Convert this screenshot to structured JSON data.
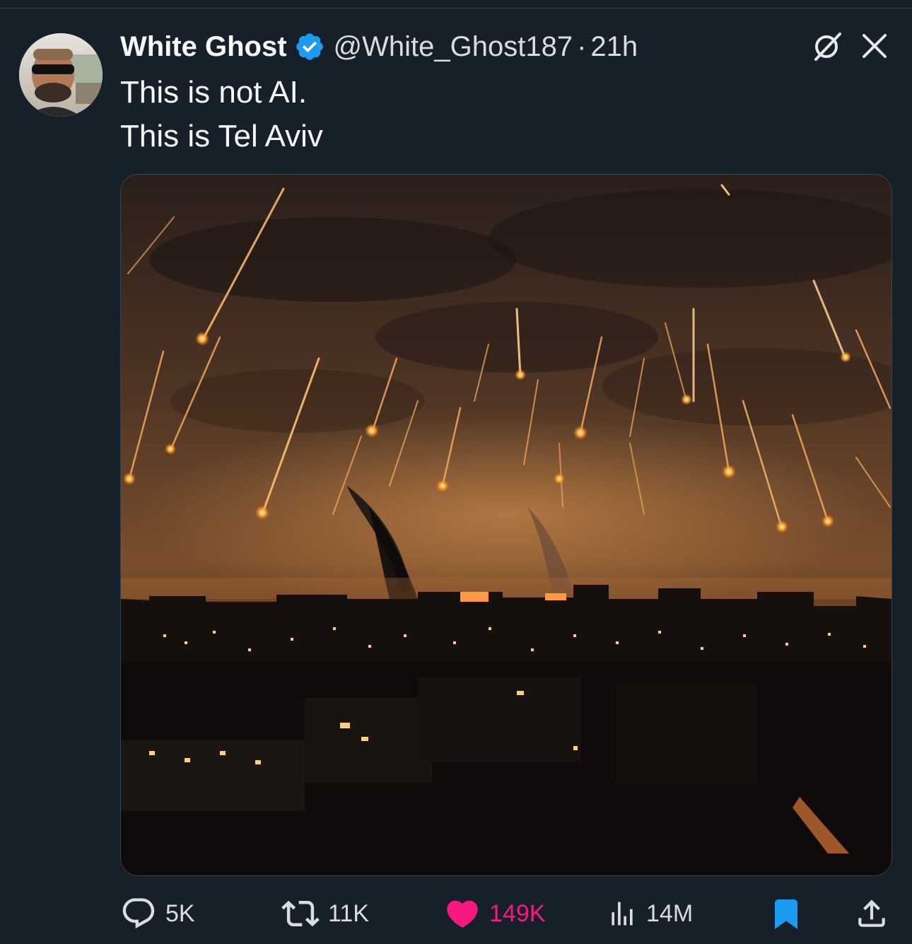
{
  "tweet": {
    "author_name": "White Ghost",
    "author_handle": "@White_Ghost187",
    "separator": "·",
    "time": "21h",
    "text_line1": "This is not AI.",
    "text_line2": "This is Tel Aviv",
    "verified_icon": "verified-badge-icon",
    "media_description_icon": "night-sky-photo"
  },
  "metrics": {
    "replies": "5K",
    "retweets": "11K",
    "likes": "149K",
    "views": "14M"
  },
  "colors": {
    "background": "#15202b",
    "text": "#f7f9f9",
    "secondary": "#d9dde0",
    "verified": "#1d9bf0",
    "like": "#f91880",
    "bookmark": "#1d9bf0"
  }
}
